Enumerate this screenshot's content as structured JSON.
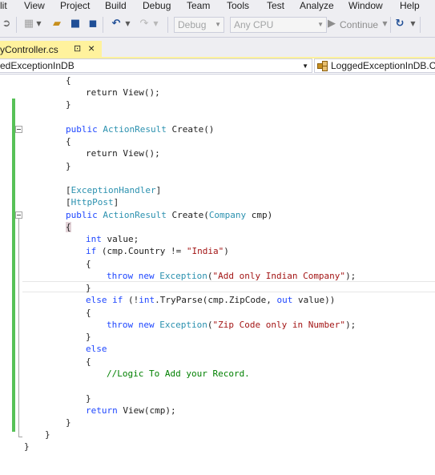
{
  "menu": {
    "items": [
      "lit",
      "View",
      "Project",
      "Build",
      "Debug",
      "Team",
      "Tools",
      "Test",
      "Analyze",
      "Window",
      "Help"
    ]
  },
  "toolbar": {
    "config_value": "Debug",
    "platform_value": "Any CPU",
    "continue_label": "Continue"
  },
  "tabs": {
    "active_label": "yController.cs",
    "pin_glyph": "⊡",
    "close_glyph": "×"
  },
  "navbar": {
    "left_value": "edExceptionInDB",
    "right_value": "LoggedExceptionInDB.Co"
  },
  "code": {
    "lines": [
      [
        [
          "{",
          "p"
        ]
      ],
      [
        [
          "return ",
          "p"
        ],
        [
          "View",
          "p"
        ],
        [
          "();",
          "p"
        ]
      ],
      [
        [
          "}",
          "p"
        ]
      ],
      [
        [
          "",
          "p"
        ]
      ],
      [
        [
          "public ",
          "kw"
        ],
        [
          "ActionResult ",
          "ty"
        ],
        [
          "Create()",
          "p"
        ]
      ],
      [
        [
          "{",
          "p"
        ]
      ],
      [
        [
          "return ",
          "p"
        ],
        [
          "View();",
          "p"
        ]
      ],
      [
        [
          "}",
          "p"
        ]
      ],
      [
        [
          "",
          "p"
        ]
      ],
      [
        [
          "[",
          "p"
        ],
        [
          "ExceptionHandler",
          "ty"
        ],
        [
          "]",
          "p"
        ]
      ],
      [
        [
          "[",
          "p"
        ],
        [
          "HttpPost",
          "ty"
        ],
        [
          "]",
          "p"
        ]
      ],
      [
        [
          "public ",
          "kw"
        ],
        [
          "ActionResult ",
          "ty"
        ],
        [
          "Create(",
          "p"
        ],
        [
          "Company ",
          "ty"
        ],
        [
          "cmp)",
          "p"
        ]
      ],
      [
        [
          "{",
          "hl"
        ]
      ],
      [
        [
          "int ",
          "kw"
        ],
        [
          "value;",
          "p"
        ]
      ],
      [
        [
          "if ",
          "kw"
        ],
        [
          "(cmp.Country != ",
          "p"
        ],
        [
          "\"India\"",
          "st"
        ],
        [
          ")",
          "p"
        ]
      ],
      [
        [
          "{",
          "p"
        ]
      ],
      [
        [
          "throw ",
          "kw"
        ],
        [
          "new ",
          "kw"
        ],
        [
          "Exception",
          "ty"
        ],
        [
          "(",
          "p"
        ],
        [
          "\"Add only Indian Company\"",
          "st"
        ],
        [
          ");",
          "p"
        ]
      ],
      [
        [
          "}",
          "p"
        ]
      ],
      [
        [
          "else ",
          "kw"
        ],
        [
          "if ",
          "kw"
        ],
        [
          "(!",
          "p"
        ],
        [
          "int",
          "kw"
        ],
        [
          ".TryParse(cmp.ZipCode, ",
          "p"
        ],
        [
          "out ",
          "kw"
        ],
        [
          "value))",
          "p"
        ]
      ],
      [
        [
          "{",
          "p"
        ]
      ],
      [
        [
          "throw ",
          "kw"
        ],
        [
          "new ",
          "kw"
        ],
        [
          "Exception",
          "ty"
        ],
        [
          "(",
          "p"
        ],
        [
          "\"Zip Code only in Number\"",
          "st"
        ],
        [
          ");",
          "p"
        ]
      ],
      [
        [
          "}",
          "p"
        ]
      ],
      [
        [
          "else",
          "kw"
        ]
      ],
      [
        [
          "{",
          "p"
        ]
      ],
      [
        [
          "//Logic To Add your Record.",
          "cm"
        ]
      ],
      [
        [
          "",
          "p"
        ]
      ],
      [
        [
          "}",
          "p"
        ]
      ],
      [
        [
          "return ",
          "kw"
        ],
        [
          "View(cmp);",
          "p"
        ]
      ],
      [
        [
          "}",
          "p"
        ]
      ],
      [
        [
          "}",
          "p"
        ]
      ],
      [
        [
          "}",
          "p"
        ]
      ]
    ]
  }
}
